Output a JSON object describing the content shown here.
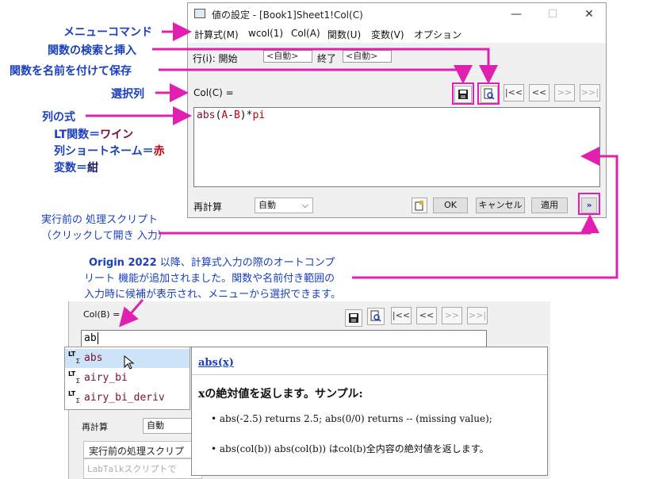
{
  "annotations": {
    "menu_command": "メニューコマンド",
    "search_insert": "関数の検索と挿入",
    "save_named": "関数を名前を付けて保存",
    "selected_col": "選択列",
    "col_formula": "列の式",
    "lt_func": "LT関数＝",
    "lt_func_color": "ワイン",
    "col_short": "列ショートネーム＝",
    "col_short_color": "赤",
    "var": "変数＝",
    "var_color": "紺",
    "pre_script_line1": "実行前の 処理スクリプト",
    "pre_script_line2": "（クリックして開き 入力）",
    "autocomplete_line1_prefix": "Origin 2022",
    "autocomplete_line1": " 以降、計算式入力の際のオートコンプ",
    "autocomplete_line2": "リート 機能が追加されました。関数や名前付き範囲の",
    "autocomplete_line3": "入力時に候補が表示され、メニューから選択できます。"
  },
  "window": {
    "title": "値の設定 - [Book1]Sheet1!Col(C)",
    "min": "—",
    "max": "☐",
    "close": "✕",
    "menu": [
      "計算式(M)",
      "wcol(1)",
      "Col(A)",
      "関数(U)",
      "変数(V)",
      "オプション"
    ],
    "row_label": "行(i): 開始",
    "row_start": "<自動>",
    "row_end_label": "終了",
    "row_end": "<自動>",
    "col_label": "Col(C) =",
    "nav": [
      "|<<",
      "<<",
      ">>",
      ">>|"
    ],
    "formula_func": "abs",
    "formula_paren_open": "(",
    "formula_col_a": "A",
    "formula_minus": "-",
    "formula_col_b": "B",
    "formula_paren_close": ")",
    "formula_op": "*",
    "formula_var": "pi",
    "recalc_label": "再計算",
    "recalc_value": "自動",
    "ok": "OK",
    "cancel": "キャンセル",
    "apply": "適用",
    "expand": "»"
  },
  "lower": {
    "col_label": "Col(B) =",
    "input_value": "ab",
    "nav": [
      "|<<",
      "<<",
      ">>",
      ">>|"
    ],
    "suggestions": [
      {
        "badge": "LT",
        "sub": "Σ",
        "name": "abs"
      },
      {
        "badge": "LT",
        "sub": "Σ",
        "name": "airy_bi"
      },
      {
        "badge": "LT",
        "sub": "Σ",
        "name": "airy_bi_deriv"
      }
    ],
    "recalc_label": "再計算",
    "recalc_value": "自動",
    "pre_tab": "実行前の処理スクリプト",
    "script_placeholder": "LabTalkスクリプトで",
    "help_title": "abs(x)",
    "help_desc": "xの絶対値を返します。サンプル:",
    "help_ex1": "abs(-2.5) returns 2.5; abs(0/0) returns -- (missing value);",
    "help_ex2": "abs(col(b)) abs(col(b)) はcol(b)全内容の絶対値を返します。"
  },
  "colors": {
    "annotation": "#1a3fbf",
    "arrow": "#e020b0",
    "func": "#7b1030",
    "col_short": "#c0000a",
    "variable": "#1a1a60"
  }
}
